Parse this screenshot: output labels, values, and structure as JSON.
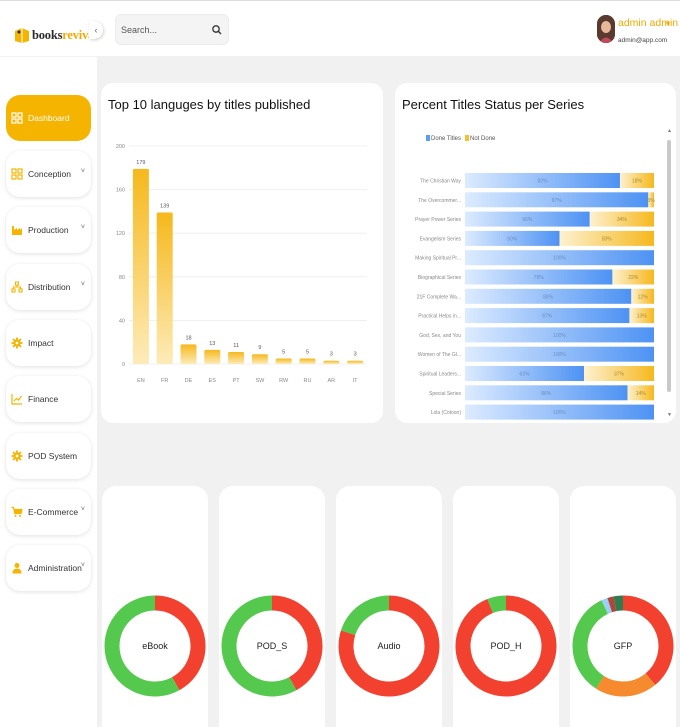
{
  "app": {
    "logo_part1": "books",
    "logo_part2": "revival"
  },
  "header": {
    "collapse_icon": "chevron-left-icon",
    "search_placeholder": "Search...",
    "search_icon": "search-icon",
    "user_name": "admin admin",
    "user_email": "admin@app.com"
  },
  "sidebar": {
    "items": [
      {
        "label": "Dashboard",
        "icon": "dashboard-icon",
        "active": true,
        "has_caret": false
      },
      {
        "label": "Conception",
        "icon": "grid-icon",
        "active": false,
        "has_caret": true
      },
      {
        "label": "Production",
        "icon": "factory-icon",
        "active": false,
        "has_caret": true
      },
      {
        "label": "Distribution",
        "icon": "sitemap-icon",
        "active": false,
        "has_caret": true
      },
      {
        "label": "Impact",
        "icon": "gear-icon",
        "active": false,
        "has_caret": false
      },
      {
        "label": "Finance",
        "icon": "chart-icon",
        "active": false,
        "has_caret": false
      },
      {
        "label": "POD System",
        "icon": "gear-icon",
        "active": false,
        "has_caret": false
      },
      {
        "label": "E-Commerce",
        "icon": "cart-icon",
        "active": false,
        "has_caret": true
      },
      {
        "label": "Administration",
        "icon": "user-icon",
        "active": false,
        "has_caret": true
      }
    ]
  },
  "colors": {
    "accent": "#f5b400",
    "done": "#5b9cf5",
    "not_done": "#f8c02a",
    "donut_green": "#55c94e",
    "donut_red": "#f2412e",
    "donut_orange": "#f58a2e"
  },
  "languages_card": {
    "title": "Top 10 languges by titles published"
  },
  "status_card": {
    "title": "Percent Titles Status per Series"
  },
  "chart_data": [
    {
      "type": "bar",
      "title": "Top 10 languges by titles published",
      "categories": [
        "EN",
        "FR",
        "DE",
        "ES",
        "PT",
        "SW",
        "RW",
        "RU",
        "AR",
        "IT"
      ],
      "values": [
        179,
        139,
        18,
        13,
        11,
        9,
        5,
        5,
        3,
        3
      ],
      "ylim": [
        0,
        200
      ],
      "yticks": [
        "0",
        "40",
        "80",
        "120",
        "160",
        "200"
      ],
      "grid": true,
      "color": "#f8c02a"
    },
    {
      "type": "bar",
      "orientation": "horizontal",
      "stacked": true,
      "title": "Percent Titles Status per Series",
      "legend": [
        "Done Titles",
        "Not Done"
      ],
      "legend_position": "top-left",
      "categories": [
        "The Christian Way",
        "The Overcommer...",
        "Prayer Power Series",
        "Evangelism Series",
        "Making Spiritual Pr...",
        "Biographical Series",
        "21F Complete Wa...",
        "Practical Helps in...",
        "God, Sex, and You",
        "Women of The Gl...",
        "Spiritual Leaders...",
        "Special Series",
        "Lola (Cotoon)"
      ],
      "series": [
        {
          "name": "Done Titles",
          "values": [
            82,
            97,
            66,
            50,
            100,
            78,
            88,
            87,
            100,
            100,
            63,
            86,
            100
          ],
          "labels": [
            "82%",
            "97%",
            "66%",
            "50%",
            "100%",
            "78%",
            "88%",
            "87%",
            "100%",
            "100%",
            "63%",
            "86%",
            "100%"
          ]
        },
        {
          "name": "Not Done",
          "values": [
            18,
            3,
            34,
            50,
            0,
            22,
            12,
            13,
            0,
            0,
            37,
            14,
            0
          ],
          "labels": [
            "18%",
            "3%",
            "34%",
            "50%",
            "",
            "22%",
            "12%",
            "13%",
            "",
            "",
            "37%",
            "14%",
            ""
          ]
        }
      ],
      "xlim": [
        0,
        100
      ]
    },
    {
      "type": "pie",
      "donuts": [
        {
          "label": "eBook",
          "slices": [
            {
              "value": 42,
              "color": "#f2412e"
            },
            {
              "value": 58,
              "color": "#55c94e"
            }
          ]
        },
        {
          "label": "POD_S",
          "slices": [
            {
              "value": 42,
              "color": "#f2412e"
            },
            {
              "value": 58,
              "color": "#55c94e"
            }
          ]
        },
        {
          "label": "Audio",
          "slices": [
            {
              "value": 80,
              "color": "#f2412e"
            },
            {
              "value": 20,
              "color": "#55c94e"
            }
          ]
        },
        {
          "label": "POD_H",
          "slices": [
            {
              "value": 94,
              "color": "#f2412e"
            },
            {
              "value": 6,
              "color": "#55c94e"
            }
          ]
        },
        {
          "label": "GFP",
          "slices": [
            {
              "value": 39,
              "color": "#f2412e"
            },
            {
              "value": 20,
              "color": "#f58a2e"
            },
            {
              "value": 34,
              "color": "#55c94e"
            },
            {
              "value": 2,
              "color": "#9ad0f5"
            },
            {
              "value": 2,
              "color": "#b0463a"
            },
            {
              "value": 3,
              "color": "#2e7d4f"
            }
          ]
        }
      ]
    }
  ]
}
